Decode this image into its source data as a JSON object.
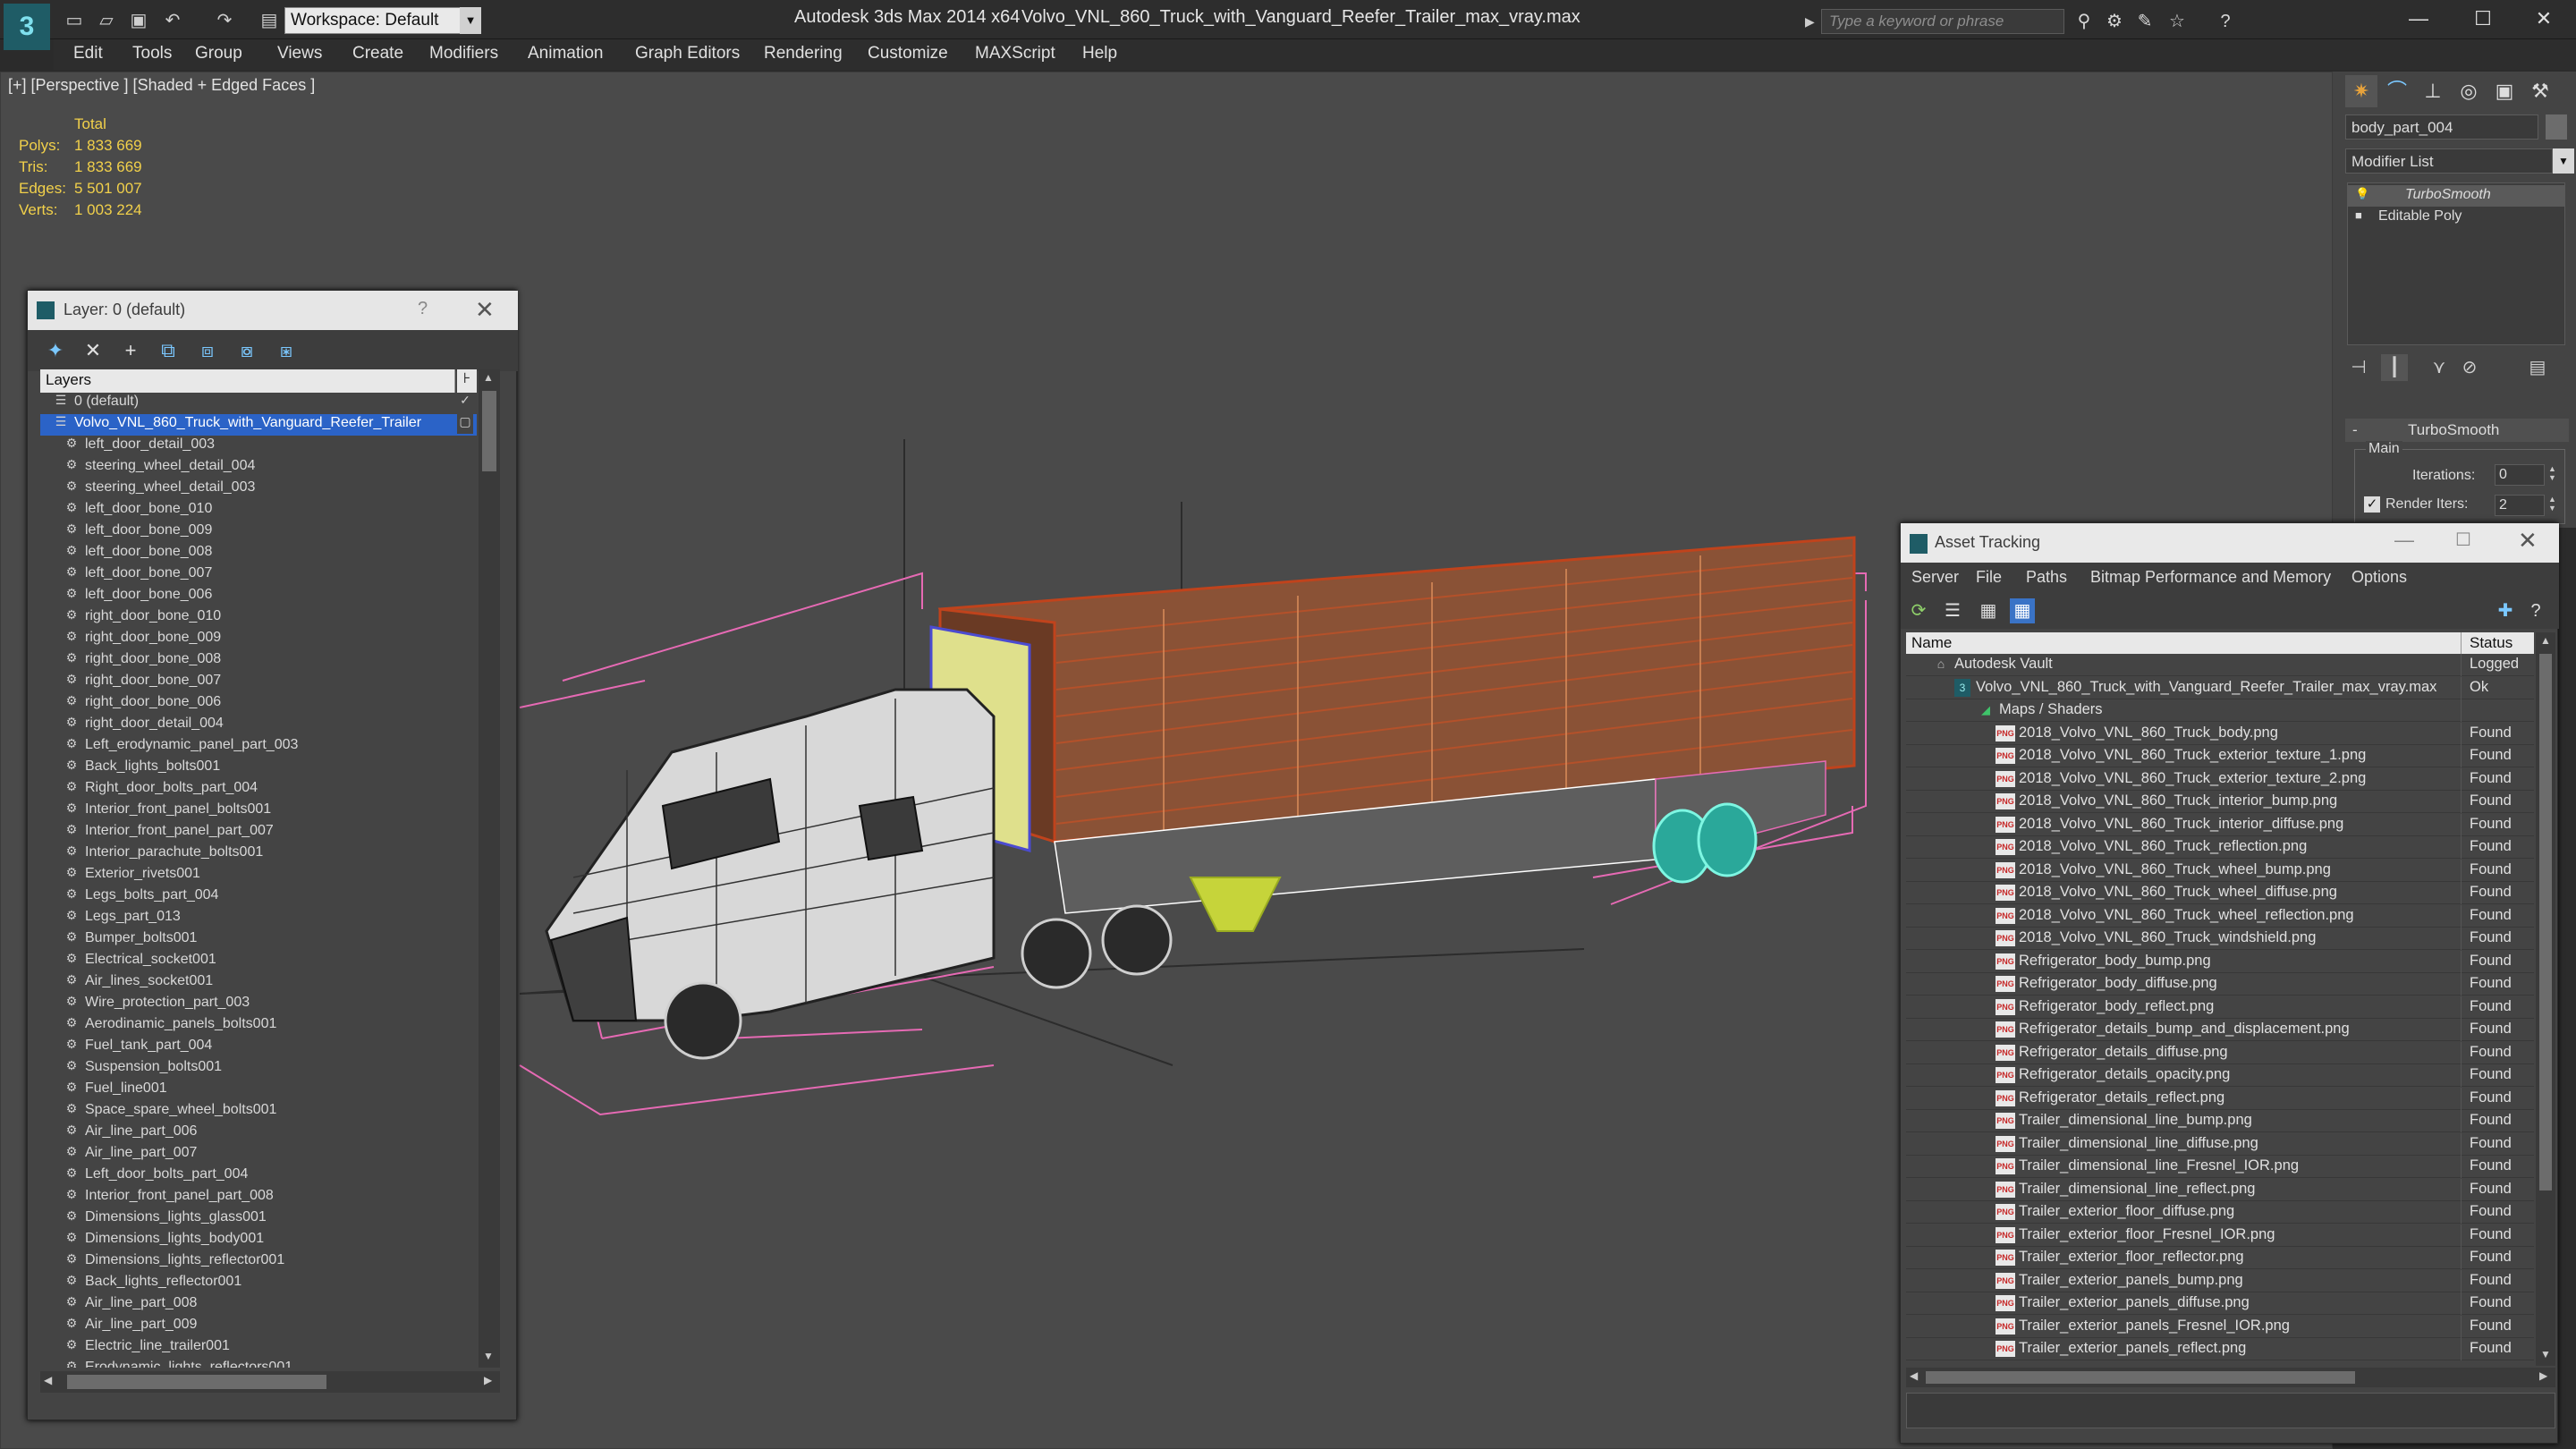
{
  "titlebar": {
    "workspace": "Workspace: Default",
    "app_title": "Autodesk 3ds Max  2014 x64",
    "file_title": "Volvo_VNL_860_Truck_with_Vanguard_Reefer_Trailer_max_vray.max",
    "search_placeholder": "Type a keyword or phrase"
  },
  "menu": [
    "Edit",
    "Tools",
    "Group",
    "Views",
    "Create",
    "Modifiers",
    "Animation",
    "Graph Editors",
    "Rendering",
    "Customize",
    "MAXScript",
    "Help"
  ],
  "viewport": {
    "label": "[+] [Perspective ] [Shaded + Edged Faces ]",
    "stats_header": "Total",
    "stats": [
      {
        "label": "Polys:",
        "value": "1 833 669"
      },
      {
        "label": "Tris:",
        "value": "1 833 669"
      },
      {
        "label": "Edges:",
        "value": "5 501 007"
      },
      {
        "label": "Verts:",
        "value": "1 003 224"
      }
    ]
  },
  "layer_panel": {
    "title": "Layer: 0 (default)",
    "help": "?",
    "close": "✕",
    "column_header": "Layers",
    "rows": [
      {
        "label": "0 (default)",
        "level": 1
      },
      {
        "label": "Volvo_VNL_860_Truck_with_Vanguard_Reefer_Trailer",
        "level": 1,
        "selected": true
      },
      {
        "label": "left_door_detail_003",
        "level": 2
      },
      {
        "label": "steering_wheel_detail_004",
        "level": 2
      },
      {
        "label": "steering_wheel_detail_003",
        "level": 2
      },
      {
        "label": "left_door_bone_010",
        "level": 2
      },
      {
        "label": "left_door_bone_009",
        "level": 2
      },
      {
        "label": "left_door_bone_008",
        "level": 2
      },
      {
        "label": "left_door_bone_007",
        "level": 2
      },
      {
        "label": "left_door_bone_006",
        "level": 2
      },
      {
        "label": "right_door_bone_010",
        "level": 2
      },
      {
        "label": "right_door_bone_009",
        "level": 2
      },
      {
        "label": "right_door_bone_008",
        "level": 2
      },
      {
        "label": "right_door_bone_007",
        "level": 2
      },
      {
        "label": "right_door_bone_006",
        "level": 2
      },
      {
        "label": "right_door_detail_004",
        "level": 2
      },
      {
        "label": "Left_erodynamic_panel_part_003",
        "level": 2
      },
      {
        "label": "Back_lights_bolts001",
        "level": 2
      },
      {
        "label": "Right_door_bolts_part_004",
        "level": 2
      },
      {
        "label": "Interior_front_panel_bolts001",
        "level": 2
      },
      {
        "label": "Interior_front_panel_part_007",
        "level": 2
      },
      {
        "label": "Interior_parachute_bolts001",
        "level": 2
      },
      {
        "label": "Exterior_rivets001",
        "level": 2
      },
      {
        "label": "Legs_bolts_part_004",
        "level": 2
      },
      {
        "label": "Legs_part_013",
        "level": 2
      },
      {
        "label": "Bumper_bolts001",
        "level": 2
      },
      {
        "label": "Electrical_socket001",
        "level": 2
      },
      {
        "label": "Air_lines_socket001",
        "level": 2
      },
      {
        "label": "Wire_protection_part_003",
        "level": 2
      },
      {
        "label": "Aerodinamic_panels_bolts001",
        "level": 2
      },
      {
        "label": "Fuel_tank_part_004",
        "level": 2
      },
      {
        "label": "Suspension_bolts001",
        "level": 2
      },
      {
        "label": "Fuel_line001",
        "level": 2
      },
      {
        "label": "Space_spare_wheel_bolts001",
        "level": 2
      },
      {
        "label": "Air_line_part_006",
        "level": 2
      },
      {
        "label": "Air_line_part_007",
        "level": 2
      },
      {
        "label": "Left_door_bolts_part_004",
        "level": 2
      },
      {
        "label": "Interior_front_panel_part_008",
        "level": 2
      },
      {
        "label": "Dimensions_lights_glass001",
        "level": 2
      },
      {
        "label": "Dimensions_lights_body001",
        "level": 2
      },
      {
        "label": "Dimensions_lights_reflector001",
        "level": 2
      },
      {
        "label": "Back_lights_reflector001",
        "level": 2
      },
      {
        "label": "Air_line_part_008",
        "level": 2
      },
      {
        "label": "Air_line_part_009",
        "level": 2
      },
      {
        "label": "Electric_line_trailer001",
        "level": 2
      },
      {
        "label": "Erodynamic_lights_reflectors001",
        "level": 2
      }
    ]
  },
  "command_panel": {
    "object_name": "body_part_004",
    "modifier_list": "Modifier List",
    "stack": [
      "TurboSmooth",
      "Editable Poly"
    ],
    "rollout_title": "TurboSmooth",
    "group_label": "Main",
    "iterations_label": "Iterations:",
    "iterations_value": "0",
    "render_iters_label": "Render Iters:",
    "render_iters_value": "2"
  },
  "asset_panel": {
    "title": "Asset Tracking",
    "menu": [
      "Server",
      "File",
      "Paths",
      "Bitmap Performance and Memory",
      "Options"
    ],
    "col_name": "Name",
    "col_status": "Status",
    "rows": [
      {
        "name": "Autodesk Vault",
        "status": "Logged",
        "kind": "vault"
      },
      {
        "name": "Volvo_VNL_860_Truck_with_Vanguard_Reefer_Trailer_max_vray.max",
        "status": "Ok",
        "kind": "max"
      },
      {
        "name": "Maps / Shaders",
        "status": "",
        "kind": "folder"
      },
      {
        "name": "2018_Volvo_VNL_860_Truck_body.png",
        "status": "Found",
        "kind": "png"
      },
      {
        "name": "2018_Volvo_VNL_860_Truck_exterior_texture_1.png",
        "status": "Found",
        "kind": "png"
      },
      {
        "name": "2018_Volvo_VNL_860_Truck_exterior_texture_2.png",
        "status": "Found",
        "kind": "png"
      },
      {
        "name": "2018_Volvo_VNL_860_Truck_interior_bump.png",
        "status": "Found",
        "kind": "png"
      },
      {
        "name": "2018_Volvo_VNL_860_Truck_interior_diffuse.png",
        "status": "Found",
        "kind": "png"
      },
      {
        "name": "2018_Volvo_VNL_860_Truck_reflection.png",
        "status": "Found",
        "kind": "png"
      },
      {
        "name": "2018_Volvo_VNL_860_Truck_wheel_bump.png",
        "status": "Found",
        "kind": "png"
      },
      {
        "name": "2018_Volvo_VNL_860_Truck_wheel_diffuse.png",
        "status": "Found",
        "kind": "png"
      },
      {
        "name": "2018_Volvo_VNL_860_Truck_wheel_reflection.png",
        "status": "Found",
        "kind": "png"
      },
      {
        "name": "2018_Volvo_VNL_860_Truck_windshield.png",
        "status": "Found",
        "kind": "png"
      },
      {
        "name": "Refrigerator_body_bump.png",
        "status": "Found",
        "kind": "png"
      },
      {
        "name": "Refrigerator_body_diffuse.png",
        "status": "Found",
        "kind": "png"
      },
      {
        "name": "Refrigerator_body_reflect.png",
        "status": "Found",
        "kind": "png"
      },
      {
        "name": "Refrigerator_details_bump_and_displacement.png",
        "status": "Found",
        "kind": "png"
      },
      {
        "name": "Refrigerator_details_diffuse.png",
        "status": "Found",
        "kind": "png"
      },
      {
        "name": "Refrigerator_details_opacity.png",
        "status": "Found",
        "kind": "png"
      },
      {
        "name": "Refrigerator_details_reflect.png",
        "status": "Found",
        "kind": "png"
      },
      {
        "name": "Trailer_dimensional_line_bump.png",
        "status": "Found",
        "kind": "png"
      },
      {
        "name": "Trailer_dimensional_line_diffuse.png",
        "status": "Found",
        "kind": "png"
      },
      {
        "name": "Trailer_dimensional_line_Fresnel_IOR.png",
        "status": "Found",
        "kind": "png"
      },
      {
        "name": "Trailer_dimensional_line_reflect.png",
        "status": "Found",
        "kind": "png"
      },
      {
        "name": "Trailer_exterior_floor_diffuse.png",
        "status": "Found",
        "kind": "png"
      },
      {
        "name": "Trailer_exterior_floor_Fresnel_IOR.png",
        "status": "Found",
        "kind": "png"
      },
      {
        "name": "Trailer_exterior_floor_reflector.png",
        "status": "Found",
        "kind": "png"
      },
      {
        "name": "Trailer_exterior_panels_bump.png",
        "status": "Found",
        "kind": "png"
      },
      {
        "name": "Trailer_exterior_panels_diffuse.png",
        "status": "Found",
        "kind": "png"
      },
      {
        "name": "Trailer_exterior_panels_Fresnel_IOR.png",
        "status": "Found",
        "kind": "png"
      },
      {
        "name": "Trailer_exterior_panels_reflect.png",
        "status": "Found",
        "kind": "png"
      }
    ]
  }
}
